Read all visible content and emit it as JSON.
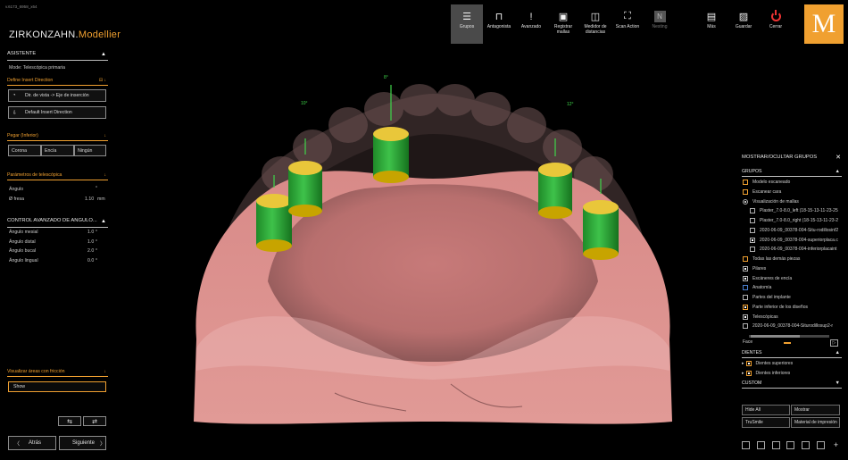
{
  "version": "v.6173_6958_x64",
  "brand": {
    "name": "ZIRKONZAHN.",
    "accent": "Modellier"
  },
  "left": {
    "asistente": "ASISTENTE",
    "mode": "Mode: Telescópica primaria",
    "define_insert": "Define Insert Direction",
    "btn_view_to_insert": "Dir. de vista -> Eje de inserción",
    "btn_default_insert": "Default Insert Direction",
    "pegar": "Pegar (Inferior)",
    "seg": [
      "Corona",
      "Encía",
      "Ningún"
    ],
    "param_tele": "Parámetros de telescópica",
    "angulo_label": "Ángulo",
    "angulo_val": "°",
    "fresa_label": "Ø fresa",
    "fresa_val": "1.10",
    "fresa_unit": "mm",
    "control": "CONTROL AVANZADO DE ANGULO...",
    "angles": [
      {
        "label": "Ángulo mesial",
        "value": "1.0",
        "unit": "°"
      },
      {
        "label": "Ángulo distal",
        "value": "1.0",
        "unit": "°"
      },
      {
        "label": "Ángulo bucal",
        "value": "2.0",
        "unit": "°"
      },
      {
        "label": "Ángulo lingual",
        "value": "0.0",
        "unit": "°"
      }
    ],
    "visualizar": "Visualizar áreas con fricción",
    "show": "Show",
    "atras": "Atrás",
    "siguiente": "Siguiente"
  },
  "toolbar": [
    {
      "label": "Grupos",
      "icon": "menu-icon",
      "active": true
    },
    {
      "label": "Antagonista",
      "icon": "antagonist-icon"
    },
    {
      "label": "Avanzado",
      "icon": "exclamation-icon"
    },
    {
      "label": "Registrar\nmallas",
      "icon": "register-icon"
    },
    {
      "label": "Medidor de\ndistancias",
      "icon": "distance-icon"
    },
    {
      "label": "Scan Action",
      "icon": "scan-icon"
    },
    {
      "label": "Nesting",
      "icon": "nesting-icon",
      "disabled": true
    }
  ],
  "toolbar_right": [
    {
      "label": "Más",
      "icon": "more-icon"
    },
    {
      "label": "Guardar",
      "icon": "save-icon"
    },
    {
      "label": "Cerrar",
      "icon": "power-icon"
    }
  ],
  "logo_letter": "M",
  "right": {
    "title": "MOSTRAR/OCULTAR GRUPOS",
    "grupos": "GRUPOS",
    "items": [
      {
        "label": "Modelo escaneado",
        "kind": "cb",
        "color": "orange",
        "checked": false,
        "indent": 0
      },
      {
        "label": "Escanear cara",
        "kind": "cb",
        "color": "orange",
        "checked": false,
        "indent": 0
      },
      {
        "label": "Visualización de mallas",
        "kind": "radio",
        "checked": true,
        "indent": 0
      },
      {
        "label": "Plaster_7.0-8.0_left (18-15-13-11-23-25",
        "kind": "cb",
        "checked": false,
        "indent": 1
      },
      {
        "label": "Plaster_7.0-8.0_right (18-15-13-11-23-2",
        "kind": "cb",
        "checked": false,
        "indent": 1
      },
      {
        "label": "2020-06-09_00378-004-Situ-rodillosinf2",
        "kind": "cb",
        "checked": false,
        "indent": 1
      },
      {
        "label": "2020-06-09_00378-004-superiorplaca.c",
        "kind": "cb",
        "checked": true,
        "indent": 1
      },
      {
        "label": "2020-06-09_00378-004-inferiorplacaint",
        "kind": "cb",
        "checked": false,
        "indent": 1
      },
      {
        "label": "Todas las demás piezas",
        "kind": "cb",
        "color": "orange",
        "checked": false,
        "indent": 0
      },
      {
        "label": "Pilares",
        "kind": "cb",
        "checked": true,
        "indent": 0
      },
      {
        "label": "Escáneres de encía",
        "kind": "cb",
        "checked": true,
        "indent": 0
      },
      {
        "label": "Anatomía",
        "kind": "cb",
        "color": "blue",
        "checked": false,
        "indent": 0
      },
      {
        "label": "Partes del implante",
        "kind": "cb",
        "checked": false,
        "indent": 0
      },
      {
        "label": "Parte inferior de los diseños",
        "kind": "cb",
        "color": "orange",
        "checked": true,
        "indent": 0
      },
      {
        "label": "Telescópicas",
        "kind": "cb",
        "checked": true,
        "indent": 0
      },
      {
        "label": "2020-06-09_00378-004-Siturodillosup2-r",
        "kind": "cb",
        "checked": false,
        "indent": 0
      }
    ],
    "face": "Face",
    "dientes": "DIENTES",
    "dientes_items": [
      {
        "label": "Dientes superiores"
      },
      {
        "label": "Dientes inferiores"
      }
    ],
    "custom": "CUSTOM",
    "grid": [
      "Hide All",
      "Mostrar",
      "TruSmile",
      "Material de impresión"
    ]
  },
  "scene": {
    "marker_labels": [
      "8°",
      "12°",
      "10°"
    ]
  }
}
